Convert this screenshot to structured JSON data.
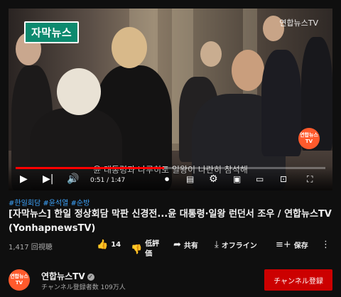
{
  "video": {
    "badge": "자막뉴스",
    "watermark": "연합뉴스TV",
    "overlay_logo": "연합뉴스TV",
    "subtitle": "윤 대통령과 나루히토 일왕이 나란히 참석해",
    "time_current": "0:51",
    "time_total": "1:47",
    "progress_fraction": 0.48,
    "accent_color": "#ff0000",
    "icons": {
      "play": "play-icon",
      "next": "next-icon",
      "volume": "volume-icon",
      "autoplay": "autoplay-toggle-icon",
      "captions": "captions-icon",
      "settings": "gear-icon",
      "miniplayer": "miniplayer-icon",
      "theater": "theater-icon",
      "cast": "cast-icon",
      "fullscreen": "fullscreen-icon"
    }
  },
  "hashtags": "#한일회담 #윤석열 #순방",
  "title": "[자막뉴스] 한일 정상회담 막판 신경전...윤 대통령·일왕 런던서 조우 / 연합뉴스TV (YonhapnewsTV)",
  "stats": {
    "views": "1,417 回視聴",
    "likes": "14",
    "dislike_label": "低評価",
    "share_label": "共有",
    "offline_label": "オフライン",
    "save_label": "保存"
  },
  "channel": {
    "name": "연합뉴스TV",
    "avatar_text": "연합뉴스TV",
    "subscribers": "チャンネル登録者数 109万人",
    "subscribe_label": "チャンネル登録",
    "brand_color": "#ff5a2c"
  }
}
